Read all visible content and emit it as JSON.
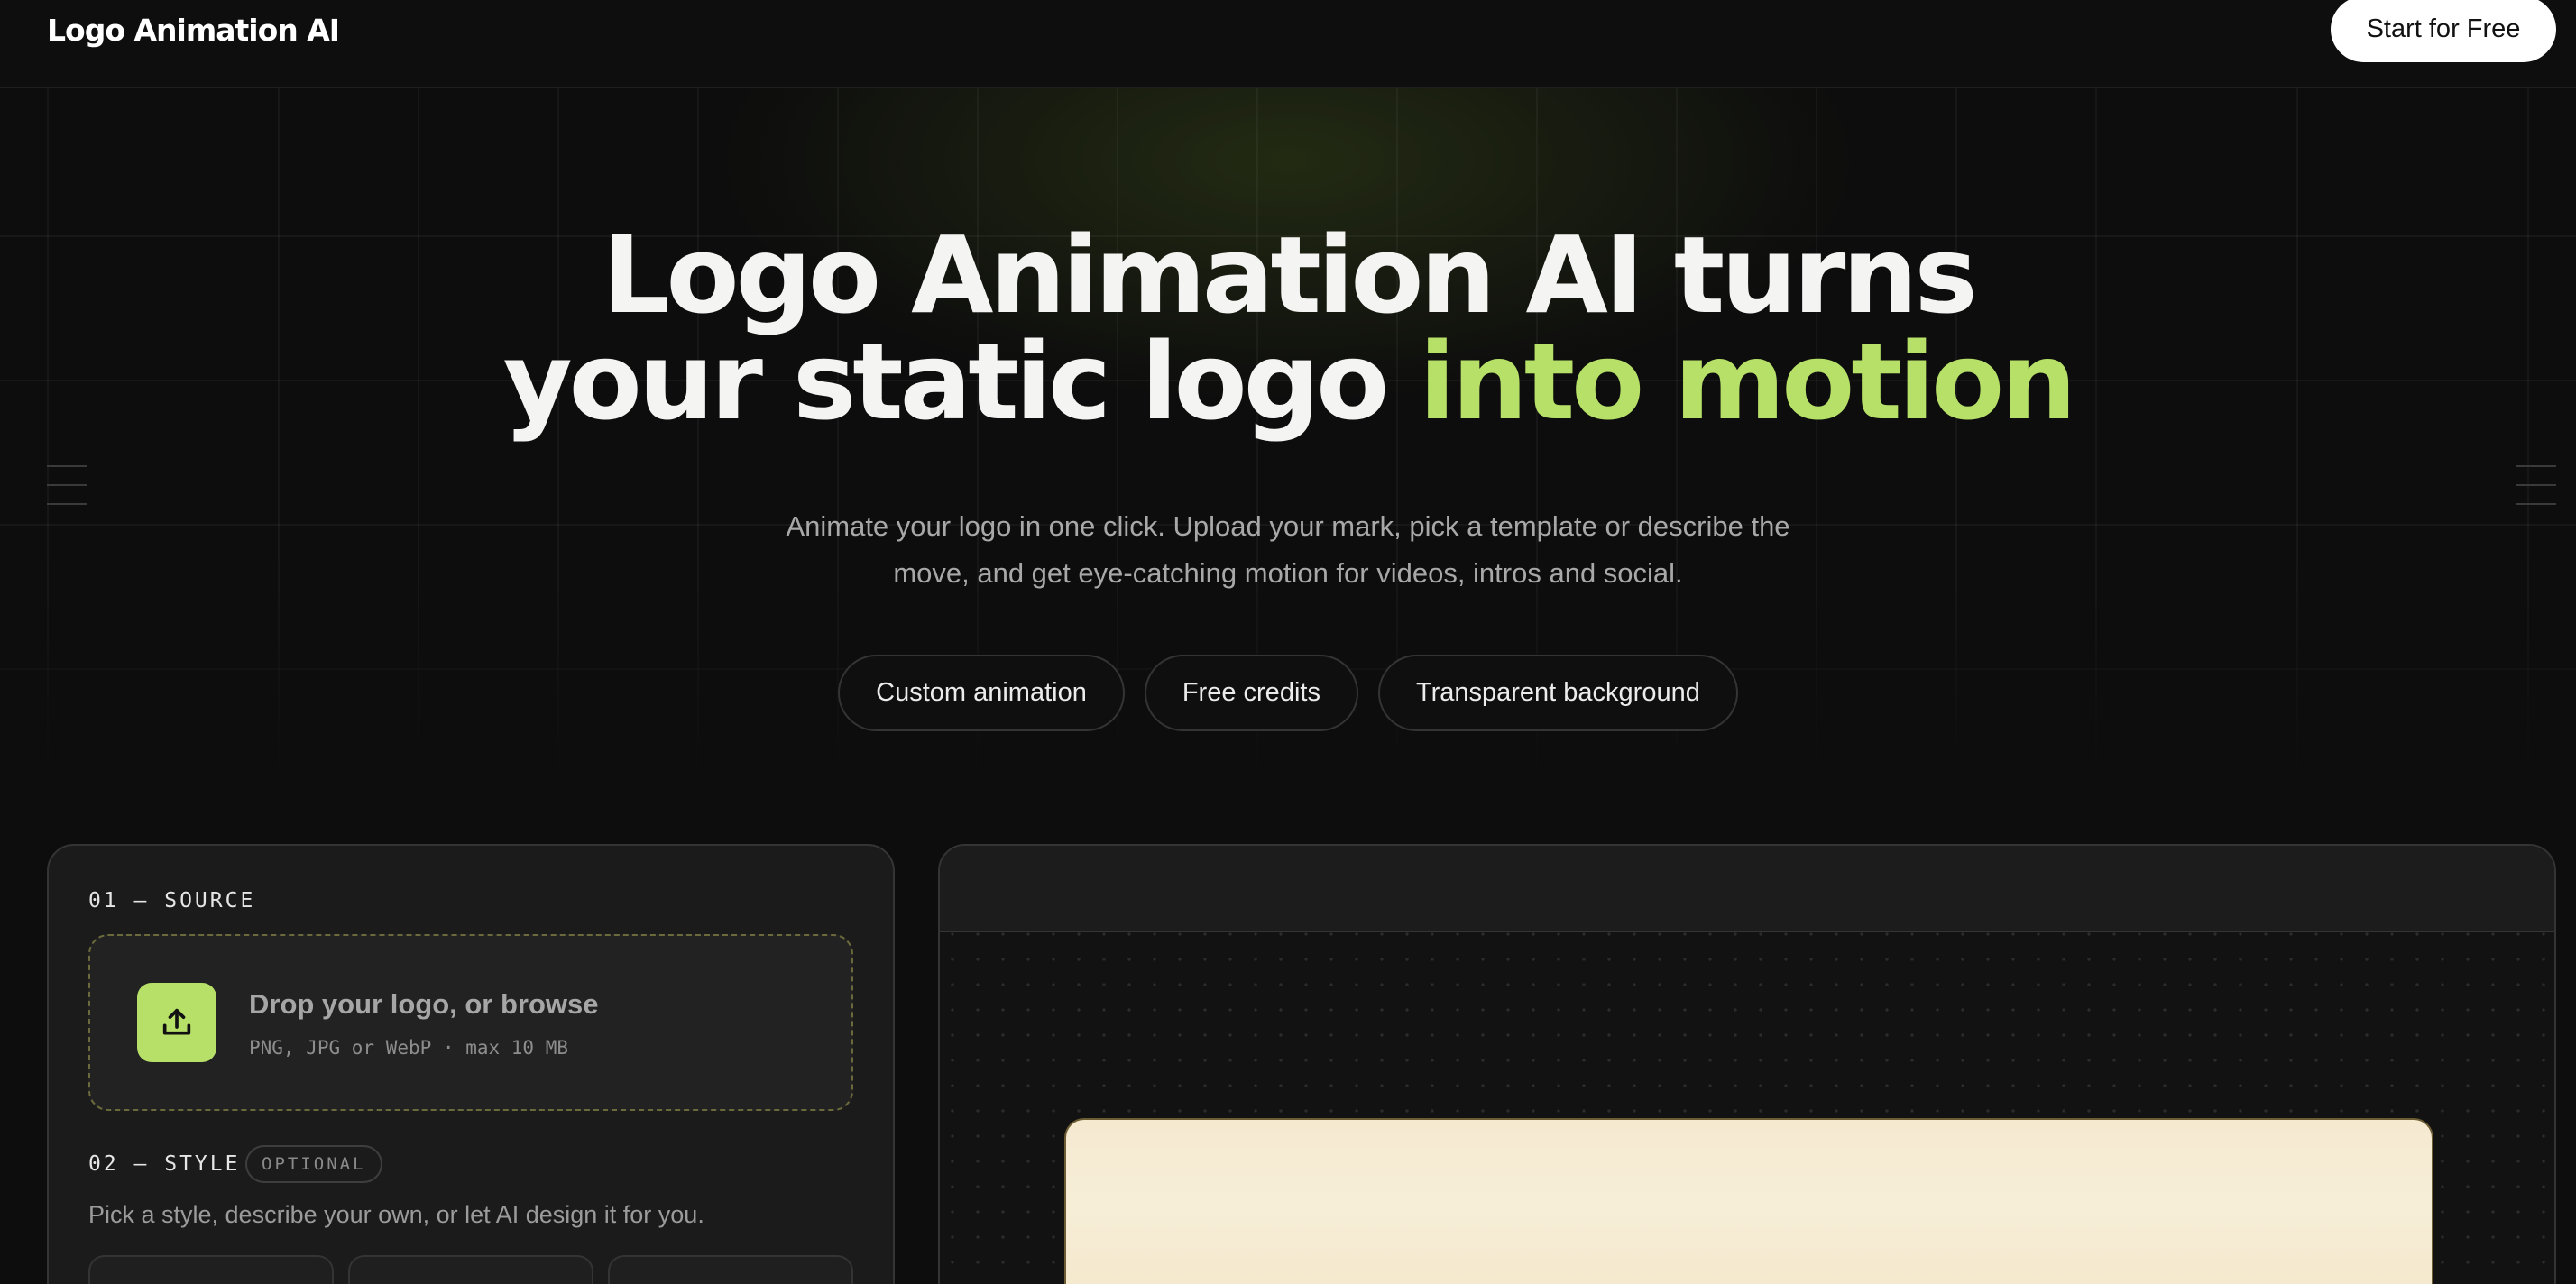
{
  "header": {
    "brand": "Logo Animation AI",
    "cta_label": "Start for Free"
  },
  "hero": {
    "title_line1": "Logo Animation AI turns",
    "title_line2_plain": "your static logo",
    "title_line2_accent": "into motion",
    "subtitle_line1": "Animate your logo in one click. Upload your mark, pick a template or describe the",
    "subtitle_line2": "move, and get eye-catching motion for videos, intros and social.",
    "chips": [
      "Custom animation",
      "Free credits",
      "Transparent background"
    ]
  },
  "source": {
    "label": "01 — SOURCE",
    "drop_title": "Drop your logo, or browse",
    "drop_sub": "PNG, JPG or WebP · max 10 MB",
    "upload_icon": "upload-icon"
  },
  "style": {
    "label": "02 — STYLE",
    "badge": "OPTIONAL",
    "hint": "Pick a style, describe your own, or let AI design it for you."
  },
  "colors": {
    "accent": "#b7e068",
    "background": "#0d0d0d",
    "panel": "#1b1b1b",
    "preview": "#f5ead0"
  }
}
